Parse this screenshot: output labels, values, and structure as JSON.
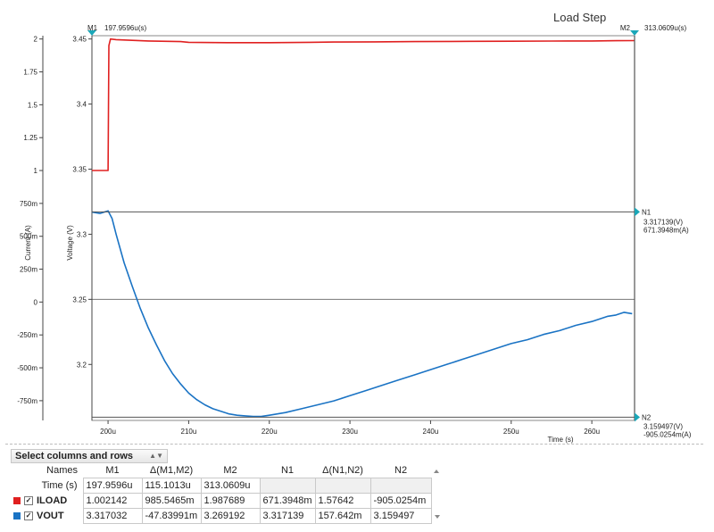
{
  "title": "Load Step",
  "chart_data": {
    "type": "line",
    "title": "Load Step",
    "xlabel": "Time (s)",
    "xlim": [
      198,
      265.3
    ],
    "xticks": [
      200,
      210,
      220,
      230,
      240,
      250,
      260
    ],
    "xtick_labels": [
      "200u",
      "210u",
      "220u",
      "230u",
      "240u",
      "250u",
      "260u"
    ],
    "axes": {
      "current": {
        "label": "Current (A)",
        "ylim": [
          -0.9,
          2.025
        ],
        "ticks": [
          2,
          1.75,
          1.5,
          1.25,
          1,
          0.75,
          0.5,
          0.25,
          0,
          -0.25,
          -0.5,
          -0.75
        ],
        "tick_labels": [
          "2",
          "1.75",
          "1.5",
          "1.25",
          "1",
          "750m",
          "500m",
          "250m",
          "0",
          "-250m",
          "-500m",
          "-750m"
        ]
      },
      "voltage": {
        "label": "Voltage (V)",
        "ylim": [
          3.157,
          3.4525
        ],
        "ticks": [
          3.45,
          3.4,
          3.35,
          3.3,
          3.25,
          3.2
        ],
        "tick_labels": [
          "3.45",
          "3.4",
          "3.35",
          "3.3",
          "3.25",
          "3.2"
        ]
      }
    },
    "series": [
      {
        "name": "ILOAD",
        "axis": "current",
        "color": "#e02020",
        "x": [
          198,
          200.0,
          200.1,
          200.3,
          201,
          203,
          205,
          209,
          210,
          215,
          220,
          225,
          228,
          233,
          238,
          245,
          250,
          255,
          260,
          263,
          265.3
        ],
        "y": [
          1.0,
          1.0,
          1.95,
          2.0,
          1.995,
          1.99,
          1.985,
          1.98,
          1.975,
          1.972,
          1.972,
          1.975,
          1.977,
          1.978,
          1.98,
          1.982,
          1.983,
          1.984,
          1.985,
          1.987,
          1.988
        ]
      },
      {
        "name": "VOUT",
        "axis": "voltage",
        "color": "#1a73c4",
        "x": [
          198,
          199,
          200,
          200.5,
          201,
          202,
          203,
          204,
          205,
          206,
          207,
          208,
          209,
          210,
          211,
          212,
          213,
          214,
          215,
          216,
          217,
          218,
          219,
          220,
          222,
          224,
          226,
          228,
          230,
          232,
          234,
          236,
          238,
          240,
          242,
          244,
          246,
          248,
          250,
          252,
          254,
          256,
          258,
          260,
          262,
          263,
          264,
          265
        ],
        "y": [
          3.317,
          3.316,
          3.318,
          3.312,
          3.3,
          3.278,
          3.26,
          3.243,
          3.228,
          3.215,
          3.203,
          3.193,
          3.185,
          3.178,
          3.173,
          3.169,
          3.166,
          3.164,
          3.162,
          3.161,
          3.1605,
          3.16,
          3.16,
          3.161,
          3.163,
          3.166,
          3.169,
          3.172,
          3.176,
          3.18,
          3.184,
          3.188,
          3.192,
          3.196,
          3.2,
          3.204,
          3.208,
          3.212,
          3.216,
          3.219,
          3.223,
          3.226,
          3.23,
          3.233,
          3.237,
          3.238,
          3.24,
          3.239
        ]
      }
    ],
    "markers": {
      "M1": {
        "label": "M1",
        "value": "197.9596u(s)",
        "x": 197.9596
      },
      "M2": {
        "label": "M2",
        "value": "313.0609u(s)",
        "x": 313.0609
      },
      "N1": {
        "label": "N1",
        "y_voltage": 3.317139,
        "values": [
          "3.317139(V)",
          "671.3948m(A)"
        ]
      },
      "N2": {
        "label": "N2",
        "y_voltage": 3.159497,
        "values": [
          "3.159497(V)",
          "-905.0254m(A)"
        ]
      }
    },
    "grid": false
  },
  "table": {
    "select_label": "Select columns and rows",
    "headers": [
      "Names",
      "M1",
      "Δ(M1,M2)",
      "M2",
      "N1",
      "Δ(N1,N2)",
      "N2"
    ],
    "time_row": {
      "label": "Time (s)",
      "values": [
        "197.9596u",
        "115.1013u",
        "313.0609u",
        "",
        "",
        ""
      ]
    },
    "signal_rows": [
      {
        "name": "ILOAD",
        "color": "#e02020",
        "values": [
          "1.002142",
          "985.5465m",
          "1.987689",
          "671.3948m",
          "1.57642",
          "-905.0254m"
        ]
      },
      {
        "name": "VOUT",
        "color": "#1a73c4",
        "values": [
          "3.317032",
          "-47.83991m",
          "3.269192",
          "3.317139",
          "157.642m",
          "3.159497"
        ]
      }
    ]
  }
}
